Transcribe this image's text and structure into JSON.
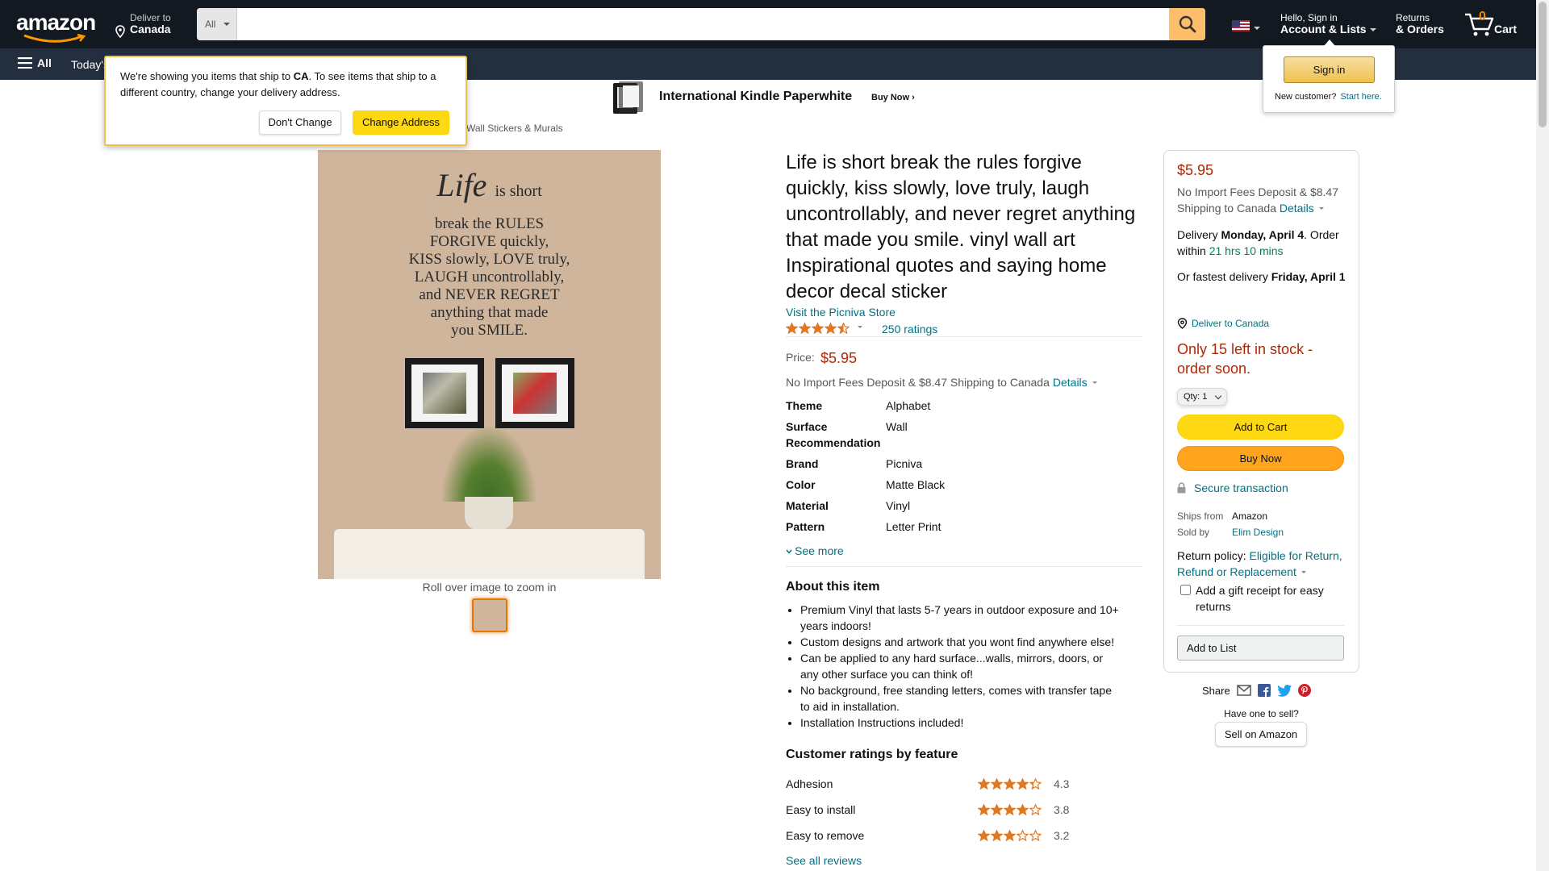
{
  "header": {
    "logo_text": "amazon",
    "deliver_to_label": "Deliver to",
    "deliver_to_country": "Canada",
    "search_category": "All",
    "search_placeholder": "",
    "account_greeting": "Hello, Sign in",
    "account_label": "Account & Lists",
    "returns_line1": "Returns",
    "returns_line2": "& Orders",
    "cart_count": "0",
    "cart_label": "Cart"
  },
  "subnav": {
    "all_label": "All",
    "today_label": "Today's"
  },
  "signin_popover": {
    "button": "Sign in",
    "new_customer": "New customer?",
    "start_here": "Start here."
  },
  "ship_popover": {
    "text_before": "We're showing you items that ship to ",
    "country": "CA",
    "text_after": ". To see items that ship to a different country, change your delivery address.",
    "dont_change": "Don't Change",
    "change_address": "Change Address"
  },
  "banner": {
    "title": "International Kindle Paperwhite",
    "cta": "Buy Now ›"
  },
  "breadcrumb": "Wall Stickers & Murals",
  "image": {
    "quote_line1": "Life",
    "quote_line1b": "is short",
    "quote_lines": [
      "break the RULES",
      "FORGIVE quickly,",
      "KISS slowly, LOVE truly,",
      "LAUGH uncontrollably,",
      "and NEVER REGRET",
      "anything that made",
      "you SMILE."
    ],
    "zoom_hint": "Roll over image to zoom in"
  },
  "product": {
    "title": "Life is short break the rules forgive quickly, kiss slowly, love truly, laugh uncontrollably, and never regret anything that made you smile. vinyl wall art Inspirational quotes and saying home decor decal sticker",
    "store_link": "Visit the Picniva Store",
    "rating": 4.5,
    "ratings_count": "250 ratings",
    "price_label": "Price:",
    "price": "$5.95",
    "import_fees": "No Import Fees Deposit & $8.47 Shipping to Canada",
    "details_link": "Details",
    "specs": [
      {
        "k": "Theme",
        "v": "Alphabet"
      },
      {
        "k": "Surface Recommendation",
        "v": "Wall"
      },
      {
        "k": "Brand",
        "v": "Picniva"
      },
      {
        "k": "Color",
        "v": "Matte Black"
      },
      {
        "k": "Material",
        "v": "Vinyl"
      },
      {
        "k": "Pattern",
        "v": "Letter Print"
      }
    ],
    "see_more": "See more",
    "about_title": "About this item",
    "about_items": [
      "Premium Vinyl that lasts 5-7 years in outdoor exposure and 10+ years indoors!",
      "Custom designs and artwork that you wont find anywhere else!",
      "Can be applied to any hard surface...walls, mirrors, doors, or any other surface you can think of!",
      "No background, free standing letters, comes with transfer tape to aid in installation.",
      "Installation Instructions included!"
    ],
    "features_title": "Customer ratings by feature",
    "features": [
      {
        "name": "Adhesion",
        "score": "4.3",
        "value": 4.3
      },
      {
        "name": "Easy to install",
        "score": "3.8",
        "value": 3.8
      },
      {
        "name": "Easy to remove",
        "score": "3.2",
        "value": 3.2
      }
    ],
    "see_all_reviews": "See all reviews"
  },
  "buybox": {
    "price": "$5.95",
    "import_fees": "No Import Fees Deposit & $8.47 Shipping to Canada",
    "details_link": "Details",
    "delivery_prefix": "Delivery",
    "delivery_date": "Monday, April 4",
    "order_within_prefix": ". Order within",
    "order_within": "21 hrs 10 mins",
    "fastest_prefix": "Or fastest delivery",
    "fastest_date": "Friday, April 1",
    "deliver_to": "Deliver to Canada",
    "stock": "Only 15 left in stock - order soon.",
    "qty_label": "Qty:",
    "qty_value": "1",
    "add_to_cart": "Add to Cart",
    "buy_now": "Buy Now",
    "secure": "Secure transaction",
    "ships_from_label": "Ships from",
    "ships_from": "Amazon",
    "sold_by_label": "Sold by",
    "sold_by": "Elim Design",
    "return_prefix": "Return policy:",
    "return_link": "Eligible for Return, Refund or Replacement",
    "gift_receipt": "Add a gift receipt for easy returns",
    "add_to_list": "Add to List",
    "share": "Share",
    "have_one": "Have one to sell?",
    "sell_on_amazon": "Sell on Amazon"
  },
  "colors": {
    "header_bg": "#131921",
    "subnav_bg": "#232f3e",
    "price_red": "#b12704",
    "link_teal": "#007185",
    "star_orange": "#de7921",
    "add_to_cart_yellow": "#ffd814",
    "buy_now_orange": "#ffa41c"
  }
}
